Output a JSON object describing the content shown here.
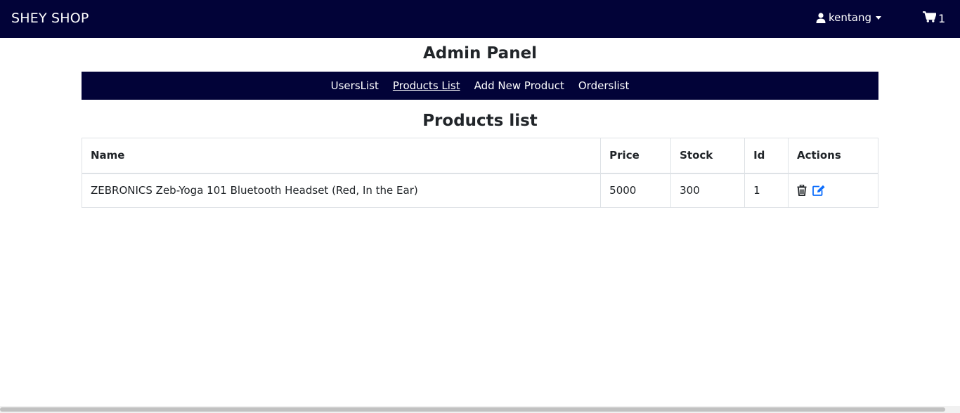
{
  "navbar": {
    "brand": "SHEY SHOP",
    "user": "kentang",
    "cart_count": "1"
  },
  "admin": {
    "title": "Admin Panel",
    "tabs": [
      {
        "label": "UsersList",
        "active": false
      },
      {
        "label": "Products List",
        "active": true
      },
      {
        "label": "Add New Product",
        "active": false
      },
      {
        "label": "Orderslist",
        "active": false
      }
    ]
  },
  "products": {
    "title": "Products list",
    "columns": [
      "Name",
      "Price",
      "Stock",
      "Id",
      "Actions"
    ],
    "rows": [
      {
        "name": "ZEBRONICS Zeb-Yoga 101 Bluetooth Headset (Red, In the Ear)",
        "price": "5000",
        "stock": "300",
        "id": "1",
        "actions": [
          "trash-icon",
          "edit-icon"
        ]
      }
    ]
  },
  "colors": {
    "navbar_bg": "#020338",
    "delete_icon": "#212529",
    "edit_icon": "#0d6efd"
  }
}
